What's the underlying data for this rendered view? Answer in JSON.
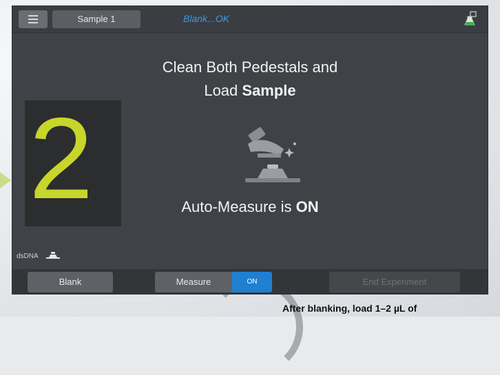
{
  "topbar": {
    "sample_tab": "Sample 1",
    "status": "Blank...OK"
  },
  "instructions": {
    "line1": "Clean Both Pedestals and",
    "line2_prefix": "Load ",
    "line2_bold": "Sample",
    "auto_prefix": "Auto-Measure is ",
    "auto_value": "ON"
  },
  "step": {
    "number": "2"
  },
  "footer_left": {
    "label": "dsDNA"
  },
  "bottombar": {
    "blank_label": "Blank",
    "measure_label": "Measure",
    "measure_toggle": "ON",
    "end_label": "End Experiment"
  },
  "caption": "After blanking, load 1–2 µL of",
  "colors": {
    "accent_blue": "#1f7fd0",
    "status_blue": "#3c9be0",
    "step_green": "#c6d62a",
    "screen_bg": "#3f4246"
  },
  "icons": [
    "menu-icon",
    "flask-icon",
    "pedestal-wipe-icon",
    "pedestal-small-icon"
  ]
}
